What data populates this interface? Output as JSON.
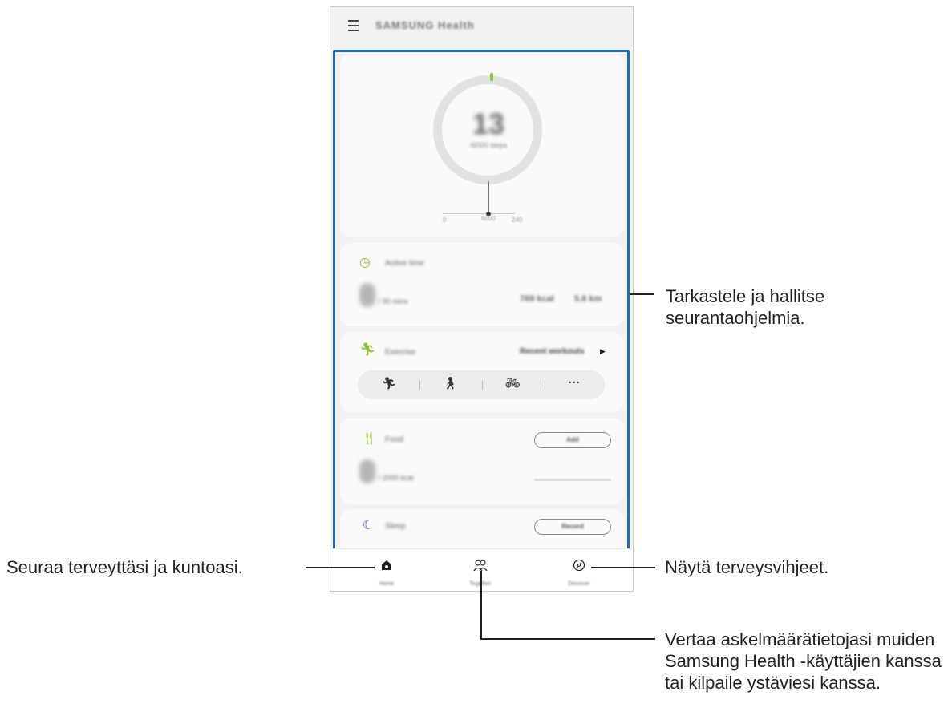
{
  "app": {
    "title": "SAMSUNG Health",
    "steps": {
      "count": "13",
      "goal_label": "/6000 steps",
      "scale": [
        "0",
        "6000",
        "240"
      ]
    },
    "cards": {
      "active_time": {
        "label": "Active time",
        "goal": "/ 90 mins",
        "kcal": "769 kcal",
        "km": "5.8 km"
      },
      "exercise": {
        "label": "Exercise",
        "recent": "Recent workouts",
        "more": "···"
      },
      "food": {
        "label": "Food",
        "goal": "/ 2000 kcal",
        "button": "Add"
      },
      "sleep": {
        "label": "Sleep",
        "button": "Record"
      }
    },
    "nav": [
      {
        "label": "Home",
        "icon": "home-icon"
      },
      {
        "label": "Together",
        "icon": "together-icon"
      },
      {
        "label": "Discover",
        "icon": "discover-icon"
      }
    ]
  },
  "callouts": {
    "trackers": "Tarkastele ja hallitse seurantaohjelmia.",
    "home": "Seuraa terveyttäsi ja kuntoasi.",
    "discover": "Näytä terveysvihjeet.",
    "together": "Vertaa askelmäärätietojasi muiden Samsung Health -käyttäjien kanssa tai kilpaile ystäviesi kanssa."
  },
  "colors": {
    "highlight": "#1e6bb8",
    "accent_green": "#8cc63f",
    "sleep_blue": "#3a4a9a"
  }
}
